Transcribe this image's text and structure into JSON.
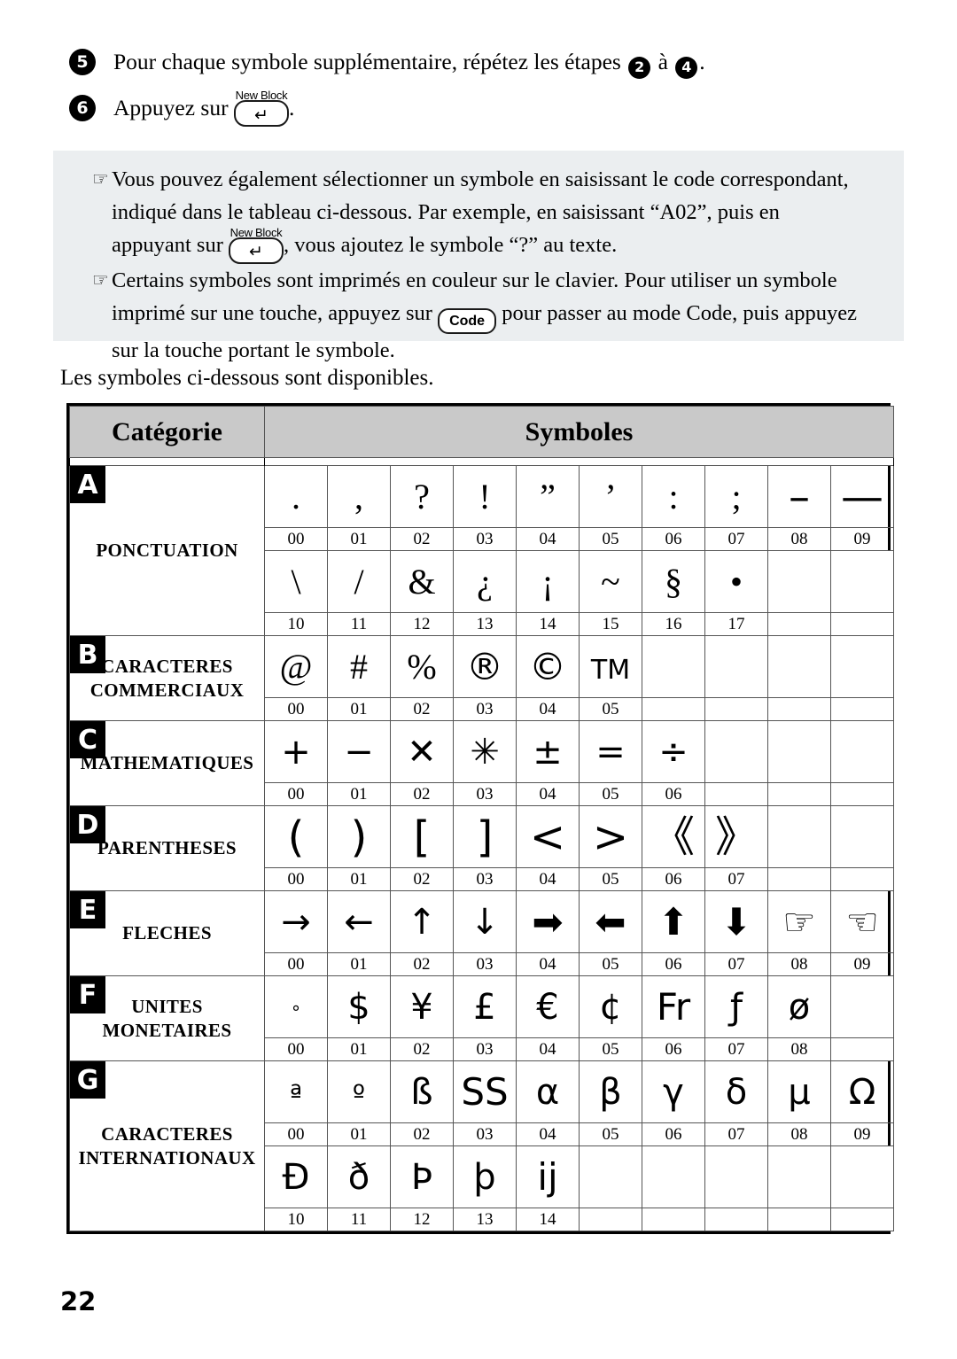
{
  "steps": [
    {
      "number": "5",
      "text_before": "Pour chaque symbole supplémentaire, répétez les étapes",
      "badge_a": "2",
      "between": "à",
      "badge_b": "4",
      "text_after": "."
    },
    {
      "number": "6",
      "text_before": "Appuyez sur",
      "key_label": "New Block",
      "key_glyph": "↵",
      "text_after": "."
    }
  ],
  "note_box": {
    "bullet_icon": "☞",
    "items": [
      {
        "lines": [
          "Vous pouvez également sélectionner un symbole en saisissant le code correspondant,",
          "indiqué dans le tableau ci-dessous. Par exemple, en saisissant “A02”, puis en"
        ],
        "last_line_before": "appuyant sur",
        "key_label": "New Block",
        "key_glyph": "↵",
        "last_line_after": ", vous ajoutez le symbole “?” au texte."
      },
      {
        "lines": [
          "Certains symboles sont imprimés en couleur sur le clavier. Pour utiliser un symbole"
        ],
        "last_line_before": "imprimé sur une touche, appuyez sur",
        "key_label": "Code",
        "key_glyph": "Code",
        "last_line_after": "pour passer au mode Code, puis appuyez",
        "extra_line": "sur la touche portant le symbole."
      }
    ]
  },
  "intro_text": "Les symboles ci-dessous sont disponibles.",
  "table": {
    "header": {
      "category": "Catégorie",
      "symbols": "Symboles"
    },
    "categories": [
      {
        "letter": "A",
        "name": "PONCTUATION",
        "rows": [
          {
            "symbols": [
              ".",
              ",",
              "?",
              "!",
              "”",
              "’",
              ":",
              ";",
              "–",
              "—"
            ],
            "codes": [
              "00",
              "01",
              "02",
              "03",
              "04",
              "05",
              "06",
              "07",
              "08",
              "09"
            ]
          },
          {
            "symbols": [
              "\\",
              "/",
              "&",
              "¿",
              "¡",
              "~",
              "§",
              "•"
            ],
            "codes": [
              "10",
              "11",
              "12",
              "13",
              "14",
              "15",
              "16",
              "17"
            ]
          }
        ]
      },
      {
        "letter": "B",
        "name": "CARACTERES COMMERCIAUX",
        "rows": [
          {
            "symbols": [
              "@",
              "#",
              "%",
              "®",
              "©",
              "TM"
            ],
            "codes": [
              "00",
              "01",
              "02",
              "03",
              "04",
              "05"
            ]
          }
        ]
      },
      {
        "letter": "C",
        "name": "MATHEMATIQUES",
        "rows": [
          {
            "symbols": [
              "+",
              "−",
              "✕",
              "✳",
              "±",
              "=",
              "÷"
            ],
            "codes": [
              "00",
              "01",
              "02",
              "03",
              "04",
              "05",
              "06"
            ]
          }
        ]
      },
      {
        "letter": "D",
        "name": "PARENTHESES",
        "rows": [
          {
            "symbols": [
              "(",
              ")",
              "[",
              "]",
              "<",
              ">",
              "《",
              "》"
            ],
            "codes": [
              "00",
              "01",
              "02",
              "03",
              "04",
              "05",
              "06",
              "07"
            ]
          }
        ]
      },
      {
        "letter": "E",
        "name": "FLECHES",
        "rows": [
          {
            "symbols": [
              "→",
              "←",
              "↑",
              "↓",
              "➡",
              "⬅",
              "⬆",
              "⬇",
              "☞",
              "☜"
            ],
            "codes": [
              "00",
              "01",
              "02",
              "03",
              "04",
              "05",
              "06",
              "07",
              "08",
              "09"
            ]
          }
        ]
      },
      {
        "letter": "F",
        "name": "UNITES MONETAIRES",
        "rows": [
          {
            "symbols": [
              "°",
              "$",
              "¥",
              "£",
              "€",
              "¢",
              "Fr",
              "ƒ",
              "ø"
            ],
            "codes": [
              "00",
              "01",
              "02",
              "03",
              "04",
              "05",
              "06",
              "07",
              "08"
            ]
          }
        ]
      },
      {
        "letter": "G",
        "name": "CARACTERES INTERNATIONAUX",
        "rows": [
          {
            "symbols": [
              "ª",
              "º",
              "ß",
              "SS",
              "α",
              "β",
              "γ",
              "δ",
              "μ",
              "Ω"
            ],
            "codes": [
              "00",
              "01",
              "02",
              "03",
              "04",
              "05",
              "06",
              "07",
              "08",
              "09"
            ]
          },
          {
            "symbols": [
              "Đ",
              "ð",
              "Þ",
              "þ",
              "ij"
            ],
            "codes": [
              "10",
              "11",
              "12",
              "13",
              "14"
            ]
          }
        ]
      }
    ]
  },
  "page_number": "22",
  "colors": {
    "note_background": "#ebeef0",
    "header_background": "#c9c9c9",
    "badge_background": "#000000",
    "text": "#000000"
  }
}
